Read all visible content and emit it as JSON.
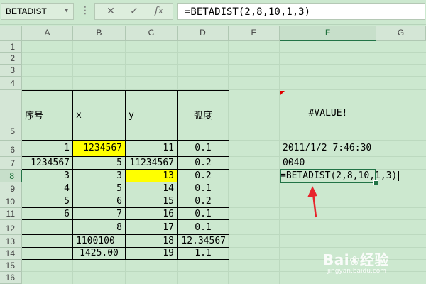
{
  "name_box": {
    "value": "BETADIST"
  },
  "formula_bar": {
    "more_icon": "vertical-dots-icon",
    "cancel_glyph": "✕",
    "enter_glyph": "✓",
    "fx_label": "fx",
    "formula": "=BETADIST(2,8,10,1,3)"
  },
  "columns": [
    "A",
    "B",
    "C",
    "D",
    "E",
    "F",
    "G"
  ],
  "active_column": "F",
  "rows": [
    "1",
    "2",
    "3",
    "4",
    "5",
    "6",
    "7",
    "8",
    "9",
    "10",
    "11",
    "12",
    "13",
    "14",
    "15",
    "16"
  ],
  "active_row": "8",
  "cells": {
    "A5": "序号",
    "B5": "x",
    "C5": "y",
    "D5": "弧度",
    "F5": "#VALUE!",
    "A6": "1",
    "B6": "1234567",
    "C6": "11",
    "D6": "0.1",
    "F6": "2011/1/2 7:46:30",
    "A7": "1234567",
    "B7": "5",
    "C7": "11234567",
    "D7": "0.2",
    "F7": "0040",
    "A8": "3",
    "B8": "3",
    "C8": "13",
    "D8": "0.2",
    "F8": "=BETADIST(2,8,10,1,3)",
    "A9": "4",
    "B9": "5",
    "C9": "14",
    "D9": "0.1",
    "A10": "5",
    "B10": "6",
    "C10": "15",
    "D10": "0.2",
    "A11": "6",
    "B11": "7",
    "C11": "16",
    "D11": "0.1",
    "B12": "8",
    "C12": "17",
    "D12": "0.1",
    "B13": "1100100",
    "C13": "18",
    "D13": "12.34567",
    "B14": "1425.00",
    "C14": "19",
    "D14": "1.1"
  },
  "colors": {
    "sheet_bg": "#cce8cf",
    "highlight": "#ffff00",
    "selection": "#217346",
    "arrow": "#e8232b"
  },
  "watermark": {
    "brand_a": "Bai",
    "brand_b": "经验",
    "url": "jingyan.baidu.com"
  }
}
